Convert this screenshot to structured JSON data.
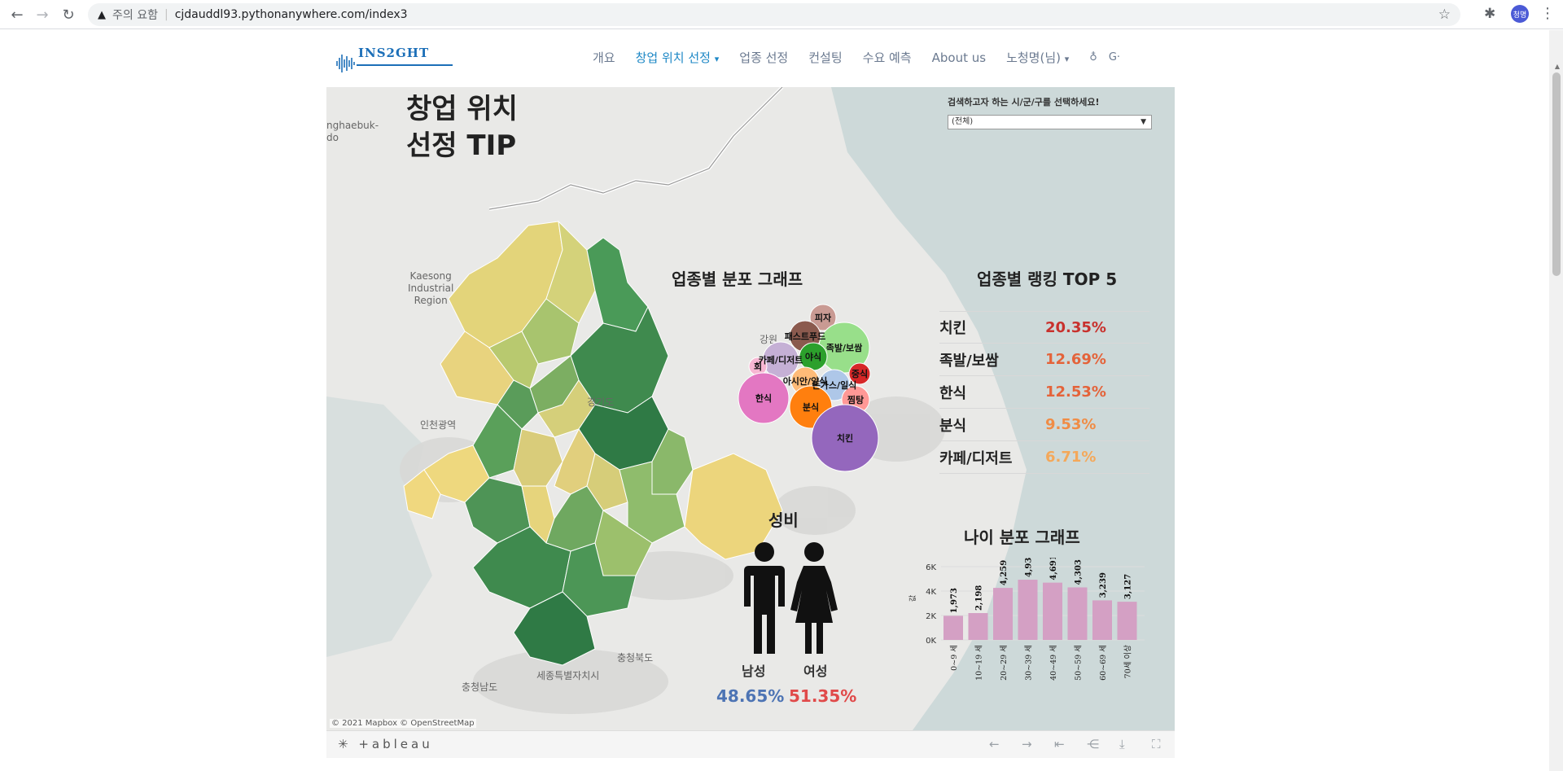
{
  "browser": {
    "security_label": "주의 요함",
    "url": "cjdauddl93.pythonanywhere.com/index3",
    "profile_initials": "청명"
  },
  "site": {
    "logo_text": "INS2GHT",
    "nav": [
      {
        "label": "개요"
      },
      {
        "label": "창업 위치 선정",
        "active": true,
        "has_caret": true
      },
      {
        "label": "업종 선정"
      },
      {
        "label": "컨설팅"
      },
      {
        "label": "수요 예측"
      },
      {
        "label": "About us"
      },
      {
        "label": "노청명(님)",
        "has_caret": true
      }
    ]
  },
  "dashboard": {
    "title_line1": "창업 위치",
    "title_line2": "선정 TIP",
    "select_label": "검색하고자 하는 시/군/구를 선택하세요!",
    "select_value": "(전체)",
    "map_labels": {
      "chungbuk_do": "nghaebuk-\ndo",
      "kaesong": "Kaesong\nIndustrial\nRegion",
      "gyeonggi": "경기도",
      "incheon": "인천광역",
      "gangwon": "강원",
      "chungbuk": "충청북도",
      "sejong": "세종특별자치시",
      "chungnam": "충청남도"
    },
    "credits": "© 2021 Mapbox  © OpenStreetMap",
    "bubble_title": "업종별 분포 그래프",
    "bubbles": [
      {
        "label": "피자",
        "color": "#c99a93"
      },
      {
        "label": "패스트푸드",
        "color": "#8b5a4e"
      },
      {
        "label": "족발/보쌈",
        "color": "#98df8a"
      },
      {
        "label": "카페/디저트",
        "color": "#c5b0d5"
      },
      {
        "label": "야식",
        "color": "#2ca02c"
      },
      {
        "label": "회",
        "color": "#f7b6d2"
      },
      {
        "label": "중식",
        "color": "#d62728"
      },
      {
        "label": "아시안/양식",
        "color": "#ffbb78"
      },
      {
        "label": "돈가스/일식",
        "color": "#aec7e8"
      },
      {
        "label": "한식",
        "color": "#e377c2"
      },
      {
        "label": "분식",
        "color": "#ff7f0e"
      },
      {
        "label": "찜탕",
        "color": "#ff9896"
      },
      {
        "label": "치킨",
        "color": "#9467bd"
      }
    ],
    "ranking_title": "업종별 랭킹 TOP 5",
    "ranking": [
      {
        "name": "치킨",
        "pct": "20.35%",
        "color": "#c8312d"
      },
      {
        "name": "족발/보쌈",
        "pct": "12.69%",
        "color": "#e4633a"
      },
      {
        "name": "한식",
        "pct": "12.53%",
        "color": "#e4633a"
      },
      {
        "name": "분식",
        "pct": "9.53%",
        "color": "#f08c45"
      },
      {
        "name": "카페/디저트",
        "pct": "6.71%",
        "color": "#f4a85a"
      }
    ],
    "gender_title": "성비",
    "male_label": "남성",
    "female_label": "여성",
    "male_pct": "48.65%",
    "female_pct": "51.35%",
    "male_color": "#4d74b4",
    "female_color": "#e04a4a"
  },
  "chart_data": {
    "type": "bar",
    "title": "나이 분포 그래프",
    "ylabel": "값",
    "categories": [
      "0~9 세",
      "10~19 세",
      "20~29 세",
      "30~39 세",
      "40~49 세",
      "50~59 세",
      "60~69 세",
      "70세 이상"
    ],
    "values": [
      1973,
      2198,
      4259,
      4930,
      4691,
      4303,
      3239,
      3127
    ],
    "data_labels": [
      "1,973",
      "2,198",
      "4,259",
      "4,930",
      "4,691",
      "4,303",
      "3,239",
      "3,127"
    ],
    "yticks": [
      "0K",
      "2K",
      "4K",
      "6K"
    ],
    "ylim": [
      0,
      6000
    ],
    "bar_color": "#d4a0c4"
  },
  "footer": {
    "logo": "+ableau"
  }
}
